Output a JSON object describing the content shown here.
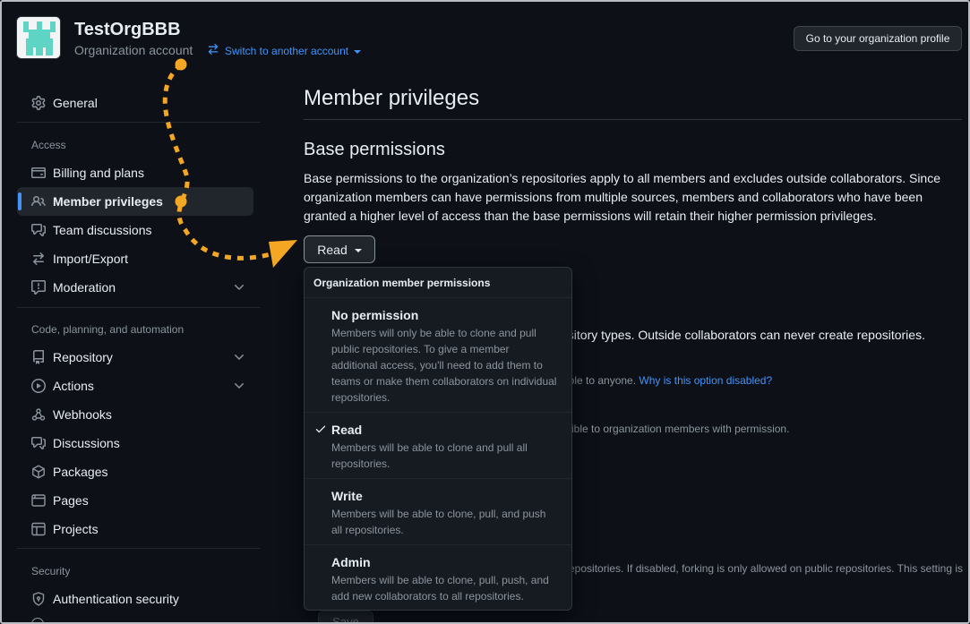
{
  "header": {
    "org_name": "TestOrgBBB",
    "org_subtitle": "Organization account",
    "switch_label": "Switch to another account",
    "profile_button": "Go to your organization profile"
  },
  "sidebar": {
    "general": "General",
    "access_heading": "Access",
    "billing": "Billing and plans",
    "member_privileges": "Member privileges",
    "team_discussions": "Team discussions",
    "import_export": "Import/Export",
    "moderation": "Moderation",
    "code_heading": "Code, planning, and automation",
    "repository": "Repository",
    "actions": "Actions",
    "webhooks": "Webhooks",
    "discussions": "Discussions",
    "packages": "Packages",
    "pages": "Pages",
    "projects": "Projects",
    "security_heading": "Security",
    "auth_security": "Authentication security"
  },
  "main": {
    "title": "Member privileges",
    "section_title": "Base permissions",
    "description": "Base permissions to the organization’s repositories apply to all members and excludes outside collaborators. Since organization members can have permissions from multiple sources, members and collaborators who have been granted a higher level of access than the base permissions will retain their higher permission privileges.",
    "base_button": "Read",
    "bg_repo_types": "ository types. Outside collaborators can never create repositories.",
    "bg_public_prefix": "ible to anyone. ",
    "bg_public_link": "Why is this option disabled?",
    "bg_private": "sible to organization members with permission.",
    "bg_forking": "epositories. If disabled, forking is only allowed on public repositories. This setting is",
    "save_button": "Save"
  },
  "dropdown": {
    "header": "Organization member permissions",
    "items": [
      {
        "title": "No permission",
        "desc": "Members will only be able to clone and pull public repositories. To give a member additional access, you'll need to add them to teams or make them collaborators on individual repositories.",
        "selected": false
      },
      {
        "title": "Read",
        "desc": "Members will be able to clone and pull all repositories.",
        "selected": true
      },
      {
        "title": "Write",
        "desc": "Members will be able to clone, pull, and push all repositories.",
        "selected": false
      },
      {
        "title": "Admin",
        "desc": "Members will be able to clone, pull, push, and add new collaborators to all repositories.",
        "selected": false
      }
    ]
  },
  "colors": {
    "background": "#0d1117",
    "accent": "#4493f8",
    "annotation": "#f5a623"
  }
}
